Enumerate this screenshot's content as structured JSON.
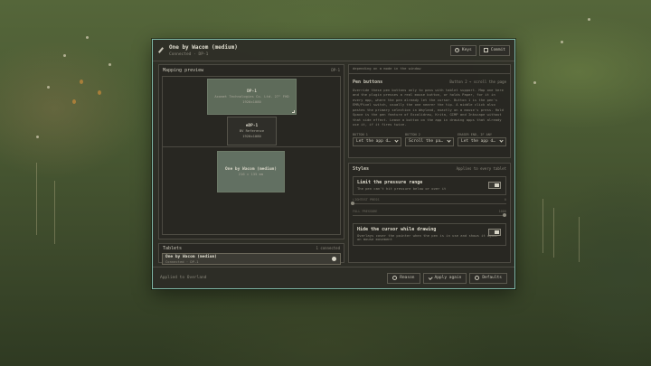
{
  "window": {
    "title": "One by Wacom (medium)",
    "subtitle": "Connected · DP-1",
    "keys_label": "Keys",
    "commit_label": "Commit"
  },
  "mapping": {
    "title": "Mapping preview",
    "output": "DP-1",
    "screens": [
      {
        "name": "DP-1",
        "line1": "Acomet Technologies Co. Ltd. 27\" FHD",
        "line2": "1920x1080"
      },
      {
        "name": "eDP-1",
        "line1": "BV Reference",
        "line2": "1920x1080"
      }
    ],
    "tablet": {
      "name": "One by Wacom (medium)",
      "size": "216 × 135 mm"
    }
  },
  "tablets": {
    "title": "Tablets",
    "count": "1 connected",
    "items": [
      {
        "name": "One by Wacom (medium)",
        "sub": "Connected · DP-1"
      }
    ]
  },
  "pen_buttons": {
    "clipped_text": "depending on a mode in the window",
    "title": "Pen buttons",
    "right_note": "Button 2 → scroll the page",
    "description": "Override these pen buttons only to pass with tablet support. Map one here and the plugin presses a real mouse button, or holds Paper, for it in every app, where the pen already let the cursor. Button 1 is the pen's EMR/Pixel switch, usually the one nearer the tip. A middle click also pastes the primary selection in Wayland, exactly on a mouse's press. Hold Space is the pen feature of Excalidraw, Krita, GIMP and Inkscape without that side effect. Leave a button on the app in drawing apps that already use it, if it fires twice.",
    "labels": [
      "BUTTON 1",
      "BUTTON 2",
      "ERASER END, IF ANY"
    ],
    "selects": [
      "Let the app d…",
      "Scroll the pa…",
      "Let the app d…"
    ]
  },
  "styles": {
    "title": "Styles",
    "right_note": "Applies to every tablet",
    "pressure": {
      "title": "Limit the pressure range",
      "desc": "The pen can't hit pressure below or over it",
      "lightest_label": "LIGHTEST PRESS",
      "lightest_value": "0",
      "lightest_fraction": 0.0,
      "full_label": "FULL PRESSURE",
      "full_value": "1000",
      "full_fraction": 1.0
    },
    "cursor": {
      "title": "Hide the cursor while drawing",
      "desc": "Overlays cover the pointer when the pen is in use and shows it again on mouse movement"
    }
  },
  "footer": {
    "status": "Applied to Overland",
    "reason_label": "Reason",
    "apply_label": "Apply again",
    "defaults_label": "Defaults"
  }
}
